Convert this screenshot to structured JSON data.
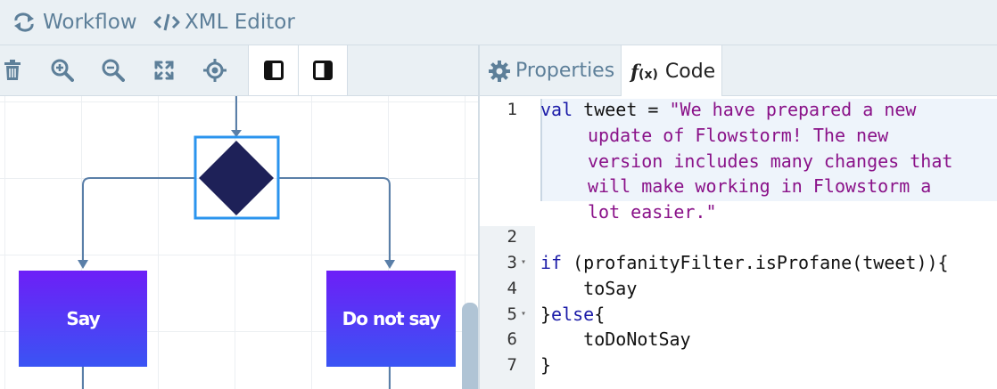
{
  "topnav": {
    "workflow_label": "Workflow",
    "xml_editor_label": "XML Editor"
  },
  "toolbar": {
    "buttons": [
      "trash-icon",
      "zoom-in-icon",
      "zoom-out-icon",
      "fit-view-icon",
      "crosshair-icon",
      "left-panel-icon",
      "right-panel-icon"
    ]
  },
  "canvas": {
    "nodes": {
      "say_label": "Say",
      "do_not_say_label": "Do not say"
    },
    "decision_color": "#1e2158",
    "selection_color": "#2b94ee",
    "connector_color": "#5a7fa8"
  },
  "right_pane": {
    "tabs": {
      "properties_label": "Properties",
      "code_label": "Code",
      "code_icon_text": "f",
      "code_icon_sub": "(x)"
    }
  },
  "editor": {
    "line_numbers": [
      "1",
      "2",
      "3",
      "4",
      "5",
      "6",
      "7"
    ],
    "line1": {
      "kw": "val",
      "ident": " tweet = ",
      "str_start": "\"We have prepared a new",
      "wrap1": "update of Flowstorm! The new",
      "wrap2": "version includes many changes that",
      "wrap3": "will make working in Flowstorm a",
      "wrap4": "lot easier.\""
    },
    "line3": {
      "kw": "if",
      "rest": " (profanityFilter.isProfane(tweet)){"
    },
    "line4": "    toSay",
    "line5": {
      "brace": "}",
      "kw": "else",
      "rest": "{"
    },
    "line6": "    toDoNotSay",
    "line7": "}",
    "fold_marker": "▾"
  }
}
